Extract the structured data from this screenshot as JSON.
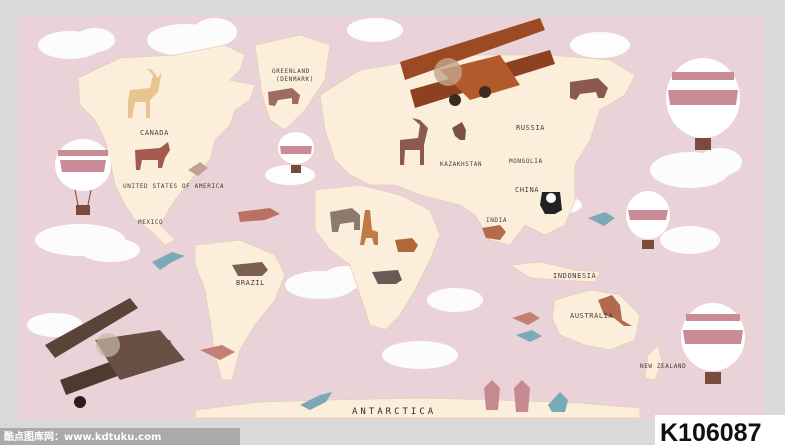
{
  "map_labels": {
    "greenland": "GREENLAND",
    "denmark": "(DENMARK)",
    "canada": "CANADA",
    "united_states": "UNITED STATES OF AMERICA",
    "mexico": "MEXICO",
    "brazil": "BRAZIL",
    "russia": "RUSSIA",
    "kazakhstan": "KAZAKHSTAN",
    "mongolia": "MONGOLIA",
    "china": "CHINA",
    "india": "INDIA",
    "indonesia": "INDONESIA",
    "australia": "AUSTRALIA",
    "new_zealand": "NEW ZEALAND",
    "antarctica": "ANTARCTICA"
  },
  "watermark": "酷点图库网：www.kdtuku.com",
  "catalog_code": "K106087",
  "colors": {
    "sky": "#ead3d8",
    "land": "#fbefdc",
    "cloud": "#ffffff",
    "plane_orange": "#9b4a23",
    "plane_brown": "#5a4438",
    "balloon_pink": "#c98b95"
  }
}
